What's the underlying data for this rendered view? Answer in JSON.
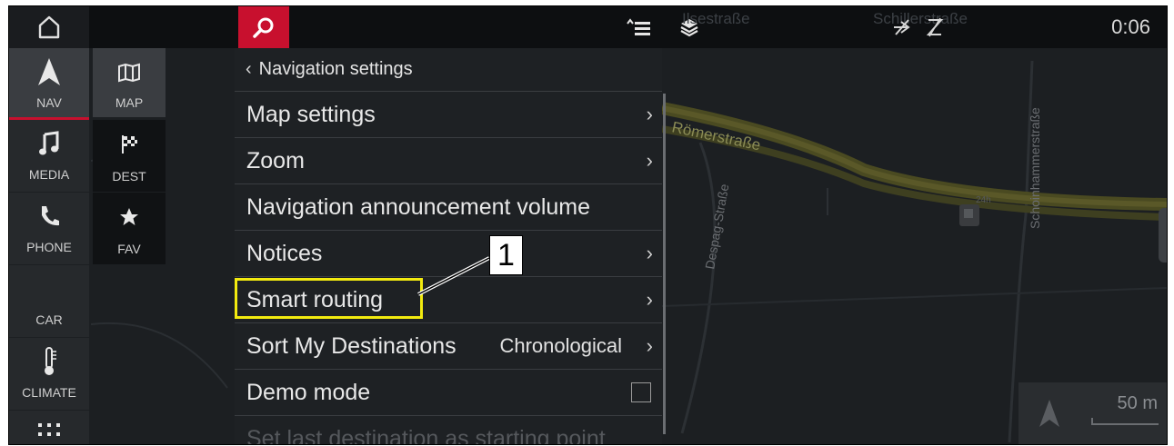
{
  "topbar": {
    "home_icon": "home-icon",
    "search_icon": "search-icon",
    "list_icon": "list-icon",
    "layers_icon": "layers-icon",
    "status_icons": [
      "navigation-off-icon",
      "data-off-icon"
    ],
    "clock": "0:06",
    "accent_color": "#c8102e"
  },
  "sidebar": {
    "main": [
      {
        "label": "NAV",
        "icon": "navigation-arrow-icon",
        "active": true
      },
      {
        "label": "MEDIA",
        "icon": "music-note-icon"
      },
      {
        "label": "PHONE",
        "icon": "phone-icon"
      },
      {
        "label": "CAR",
        "icon": ""
      },
      {
        "label": "CLIMATE",
        "icon": "thermometer-icon"
      },
      {
        "label": "",
        "icon": "apps-grid-icon"
      }
    ],
    "sub": [
      {
        "label": "MAP",
        "icon": "map-icon",
        "active": true
      },
      {
        "label": "DEST",
        "icon": "checkered-flag-icon"
      },
      {
        "label": "FAV",
        "icon": "star-icon"
      }
    ]
  },
  "menu": {
    "header": "Navigation settings",
    "back_icon": "chevron-left-icon",
    "rows": [
      {
        "label": "Map settings",
        "value": "",
        "chevron": true
      },
      {
        "label": "Zoom",
        "value": "",
        "chevron": true
      },
      {
        "label": "Navigation announcement volume",
        "value": "",
        "chevron": false
      },
      {
        "label": "Notices",
        "value": "",
        "chevron": true
      },
      {
        "label": "Smart routing",
        "value": "",
        "chevron": true
      },
      {
        "label": "Sort My Destinations",
        "value": "Chronological",
        "chevron": true
      },
      {
        "label": "Demo mode",
        "value": "",
        "checkbox": true,
        "checked": false
      },
      {
        "label": "Set last destination as starting point",
        "value": "",
        "faded": true
      }
    ],
    "chevron_glyph": "›"
  },
  "callout": {
    "number": "1",
    "highlight_color": "#f2ea0f"
  },
  "map": {
    "streets": [
      "Römerstraße",
      "Despag-Straße",
      "Schoinhammerstraße",
      "Ilsestraße",
      "Schillerstraße"
    ],
    "poi_label": "24h",
    "scale": "50 m"
  }
}
